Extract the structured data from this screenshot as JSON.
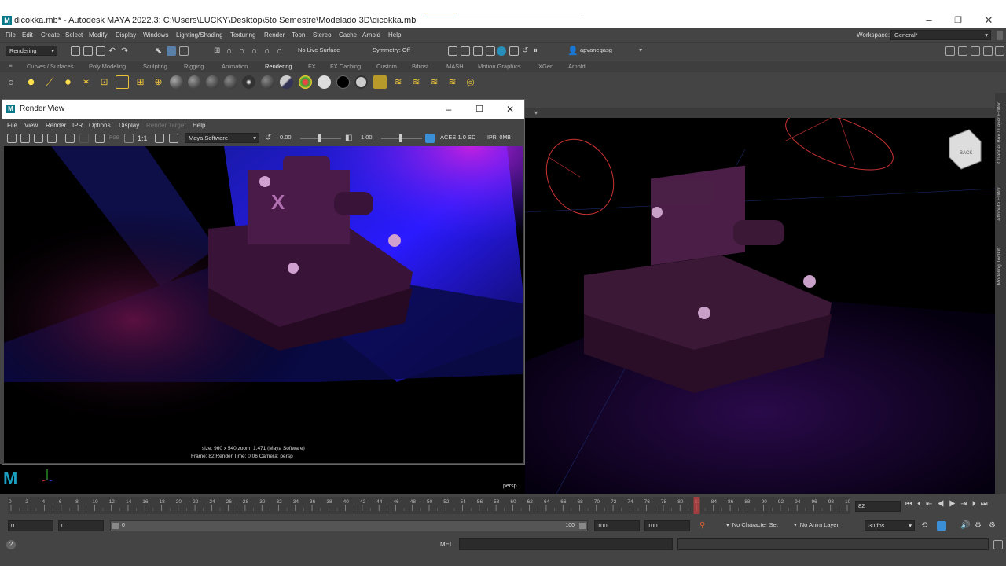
{
  "window": {
    "title": "dicokka.mb* - Autodesk MAYA 2022.3: C:\\Users\\LUCKY\\Desktop\\5to Semestre\\Modelado 3D\\dicokka.mb",
    "logo": "M",
    "minimize": "–",
    "restore": "❐",
    "close": "✕"
  },
  "menubar": {
    "items": [
      "File",
      "Edit",
      "Create",
      "Select",
      "Modify",
      "Display",
      "Windows",
      "Lighting/Shading",
      "Texturing",
      "Render",
      "Toon",
      "Stereo",
      "Cache",
      "Arnold",
      "Help"
    ],
    "workspace_label": "Workspace:",
    "workspace_value": "General*"
  },
  "statusline": {
    "menuset": "Rendering",
    "live_surface": "No Live Surface",
    "symmetry": "Symmetry: Off",
    "user": "apvanegasg"
  },
  "shelf": {
    "tabs": [
      "Curves / Surfaces",
      "Poly Modeling",
      "Sculpting",
      "Rigging",
      "Animation",
      "Rendering",
      "FX",
      "FX Caching",
      "Custom",
      "Bifrost",
      "MASH",
      "Motion Graphics",
      "XGen",
      "Arnold"
    ],
    "active_tab": "Rendering"
  },
  "right_panel": {
    "tabs": [
      "Channel Box / Layer Editor",
      "Attribute Editor",
      "Modeling Toolkit"
    ]
  },
  "viewport": {
    "camera_label": "persp",
    "viewcube_label": "BACK"
  },
  "render_view": {
    "title": "Render View",
    "logo": "M",
    "menu": [
      "File",
      "View",
      "Render",
      "IPR",
      "Options",
      "Display",
      "Render Target",
      "Help"
    ],
    "ratio": "1:1",
    "renderer": "Maya Software",
    "exposure": "0.00",
    "gamma": "1.00",
    "colorspace": "ACES 1.0 SD",
    "ipr": "IPR: 0MB",
    "info_line1": "size:  960 x 540  zoom: 1.471       (Maya Software)",
    "info_line2": "Frame: 82       Render Time: 0:06        Camera: persp"
  },
  "timeline": {
    "ticks": [
      "0",
      "2",
      "4",
      "6",
      "8",
      "10",
      "12",
      "14",
      "16",
      "18",
      "20",
      "22",
      "24",
      "26",
      "28",
      "30",
      "32",
      "34",
      "36",
      "38",
      "40",
      "42",
      "44",
      "46",
      "48",
      "50",
      "52",
      "54",
      "56",
      "58",
      "60",
      "62",
      "64",
      "66",
      "68",
      "70",
      "72",
      "74",
      "76",
      "78",
      "80",
      "82",
      "84",
      "86",
      "88",
      "90",
      "92",
      "94",
      "96",
      "98",
      "100"
    ],
    "current_frame": "82",
    "current_frame_field": "82"
  },
  "range": {
    "start": "0",
    "anim_start": "0",
    "slider_start": "0",
    "slider_end": "100",
    "end": "100",
    "anim_end": "100",
    "character_set": "No Character Set",
    "anim_layer": "No Anim Layer",
    "fps": "30 fps"
  },
  "command_line": {
    "language": "MEL",
    "help": "?"
  },
  "colors": {
    "accent": "#3a8fd6",
    "maya_teal": "#0a7a8a",
    "current_frame": "#c04040"
  }
}
